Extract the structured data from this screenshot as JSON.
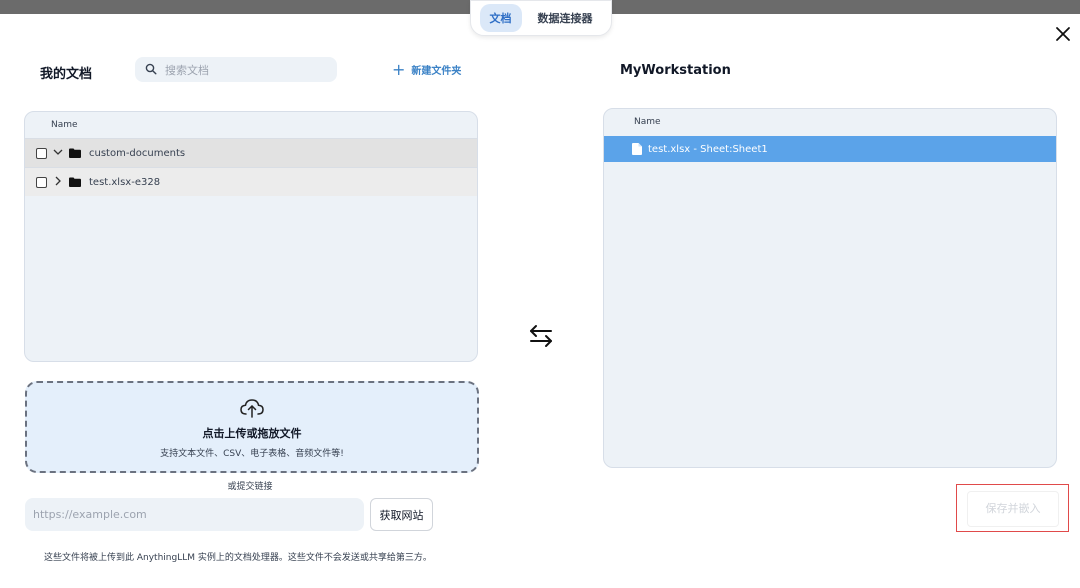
{
  "tabs": [
    {
      "label": "文档",
      "active": true
    },
    {
      "label": "数据连接器",
      "active": false
    }
  ],
  "left": {
    "title": "我的文档",
    "search_placeholder": "搜索文档",
    "new_folder_label": "新建文件夹",
    "column_header": "Name",
    "rows": [
      {
        "name": "custom-documents",
        "expanded": true
      },
      {
        "name": "test.xlsx-e328",
        "expanded": false
      }
    ]
  },
  "upload": {
    "title": "点击上传或拖放文件",
    "subtitle": "支持文本文件、CSV、电子表格、音频文件等!",
    "or_link_label": "或提交链接",
    "url_placeholder": "https://example.com",
    "fetch_label": "获取网站",
    "footnote": "这些文件将被上传到此 AnythingLLM 实例上的文档处理器。这些文件不会发送或共享给第三方。"
  },
  "right": {
    "title": "MyWorkstation",
    "column_header": "Name",
    "rows": [
      {
        "name": "test.xlsx - Sheet:Sheet1",
        "selected": true
      }
    ]
  },
  "save_button_label": "保存并嵌入",
  "icons": {
    "close": "close-icon",
    "search": "search-icon",
    "plus": "plus-icon",
    "folder": "folder-icon",
    "file": "file-icon",
    "swap": "swap-arrows-icon",
    "upload": "cloud-upload-icon"
  },
  "colors": {
    "accent": "#3b82c6",
    "selected_row": "#5ba3e9",
    "panel_bg": "#edf2f7",
    "dropzone_bg": "#e4effb",
    "highlight_border": "#e04a4a"
  }
}
